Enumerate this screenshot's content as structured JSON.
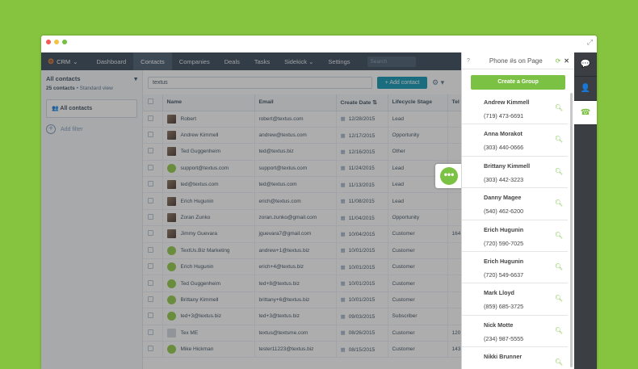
{
  "nav": {
    "logo": "CRM",
    "items": [
      "Dashboard",
      "Contacts",
      "Companies",
      "Deals",
      "Tasks",
      "Sidekick",
      "Settings"
    ],
    "search_placeholder": "Search"
  },
  "sidebar": {
    "view_title": "All contacts",
    "count": "25 contacts",
    "view_type": "Standard view",
    "saved_view": "All contacts",
    "add_filter": "Add filter"
  },
  "toolbar": {
    "filter_value": "textus",
    "add_contact": "Add contact"
  },
  "table": {
    "headers": [
      "Name",
      "Email",
      "Create Date",
      "Lifecycle Stage",
      "Tel"
    ],
    "rows": [
      {
        "name": "Robert",
        "email": "robert@textus.com",
        "date": "12/28/2015",
        "stage": "Lead",
        "tel": "",
        "avatar": "photo"
      },
      {
        "name": "Andrew Kimmell",
        "email": "andrew@textus.com",
        "date": "12/17/2015",
        "stage": "Opportunity",
        "tel": "",
        "avatar": "photo"
      },
      {
        "name": "Ted Guggenheim",
        "email": "ted@textus.biz",
        "date": "12/16/2015",
        "stage": "Other",
        "tel": "",
        "avatar": "photo"
      },
      {
        "name": "support@textus.com",
        "email": "support@textus.com",
        "date": "11/24/2015",
        "stage": "Lead",
        "tel": "",
        "avatar": "textus"
      },
      {
        "name": "ted@textus.com",
        "email": "ted@textus.com",
        "date": "11/13/2015",
        "stage": "Lead",
        "tel": "",
        "avatar": "photo"
      },
      {
        "name": "Erich Hugunin",
        "email": "erich@textus.com",
        "date": "11/08/2015",
        "stage": "Lead",
        "tel": "",
        "avatar": "photo"
      },
      {
        "name": "Zoran Zunko",
        "email": "zoran.zunko@gmail.com",
        "date": "11/04/2015",
        "stage": "Opportunity",
        "tel": "",
        "avatar": "photo"
      },
      {
        "name": "Jimmy Guevara",
        "email": "jguevara7@gmail.com",
        "date": "10/04/2015",
        "stage": "Customer",
        "tel": "164",
        "avatar": "photo"
      },
      {
        "name": "TextUs.Biz Marketing",
        "email": "andrew+1@textus.biz",
        "date": "10/01/2015",
        "stage": "Customer",
        "tel": "",
        "avatar": "textus"
      },
      {
        "name": "Erich Hugunin",
        "email": "erich+4@textus.biz",
        "date": "10/01/2015",
        "stage": "Customer",
        "tel": "",
        "avatar": "textus"
      },
      {
        "name": "Ted Guggenheim",
        "email": "ted+8@textus.biz",
        "date": "10/01/2015",
        "stage": "Customer",
        "tel": "",
        "avatar": "textus"
      },
      {
        "name": "Brittany Kimmell",
        "email": "brittany+6@textus.biz",
        "date": "10/01/2015",
        "stage": "Customer",
        "tel": "",
        "avatar": "textus"
      },
      {
        "name": "ted+3@textus.biz",
        "email": "ted+3@textus.biz",
        "date": "09/03/2015",
        "stage": "Subscriber",
        "tel": "",
        "avatar": "textus"
      },
      {
        "name": "Tex ME",
        "email": "textus@textsme.com",
        "date": "08/26/2015",
        "stage": "Customer",
        "tel": "120",
        "avatar": "grey"
      },
      {
        "name": "Mike Hickman",
        "email": "tester11223@textus.biz",
        "date": "08/15/2015",
        "stage": "Customer",
        "tel": "143",
        "avatar": "textus"
      }
    ]
  },
  "panel": {
    "title": "Phone #s on Page",
    "group_button": "Create a Group",
    "contacts": [
      {
        "name": "Andrew Kimmell",
        "phone": "(719) 473-6691"
      },
      {
        "name": "Anna Morakot",
        "phone": "(303) 440-0666"
      },
      {
        "name": "Brittany Kimmell",
        "phone": "(303) 442-3223"
      },
      {
        "name": "Danny Magee",
        "phone": "(540) 462-6200"
      },
      {
        "name": "Erich Hugunin",
        "phone": "(720) 590-7025"
      },
      {
        "name": "Erich Hugunin",
        "phone": "(720) 549-6637"
      },
      {
        "name": "Mark Lloyd",
        "phone": "(859) 685-3725"
      },
      {
        "name": "Nick Motte",
        "phone": "(234) 987-5555"
      },
      {
        "name": "Nikki Brunner",
        "phone": ""
      }
    ]
  },
  "icons": {
    "dock": [
      "chat-icon",
      "user-icon",
      "phone-icon"
    ]
  },
  "colors": {
    "background": "#86c440",
    "accent": "#7bc143",
    "nav": "#2d3e50",
    "primary_button": "#0091ae"
  }
}
